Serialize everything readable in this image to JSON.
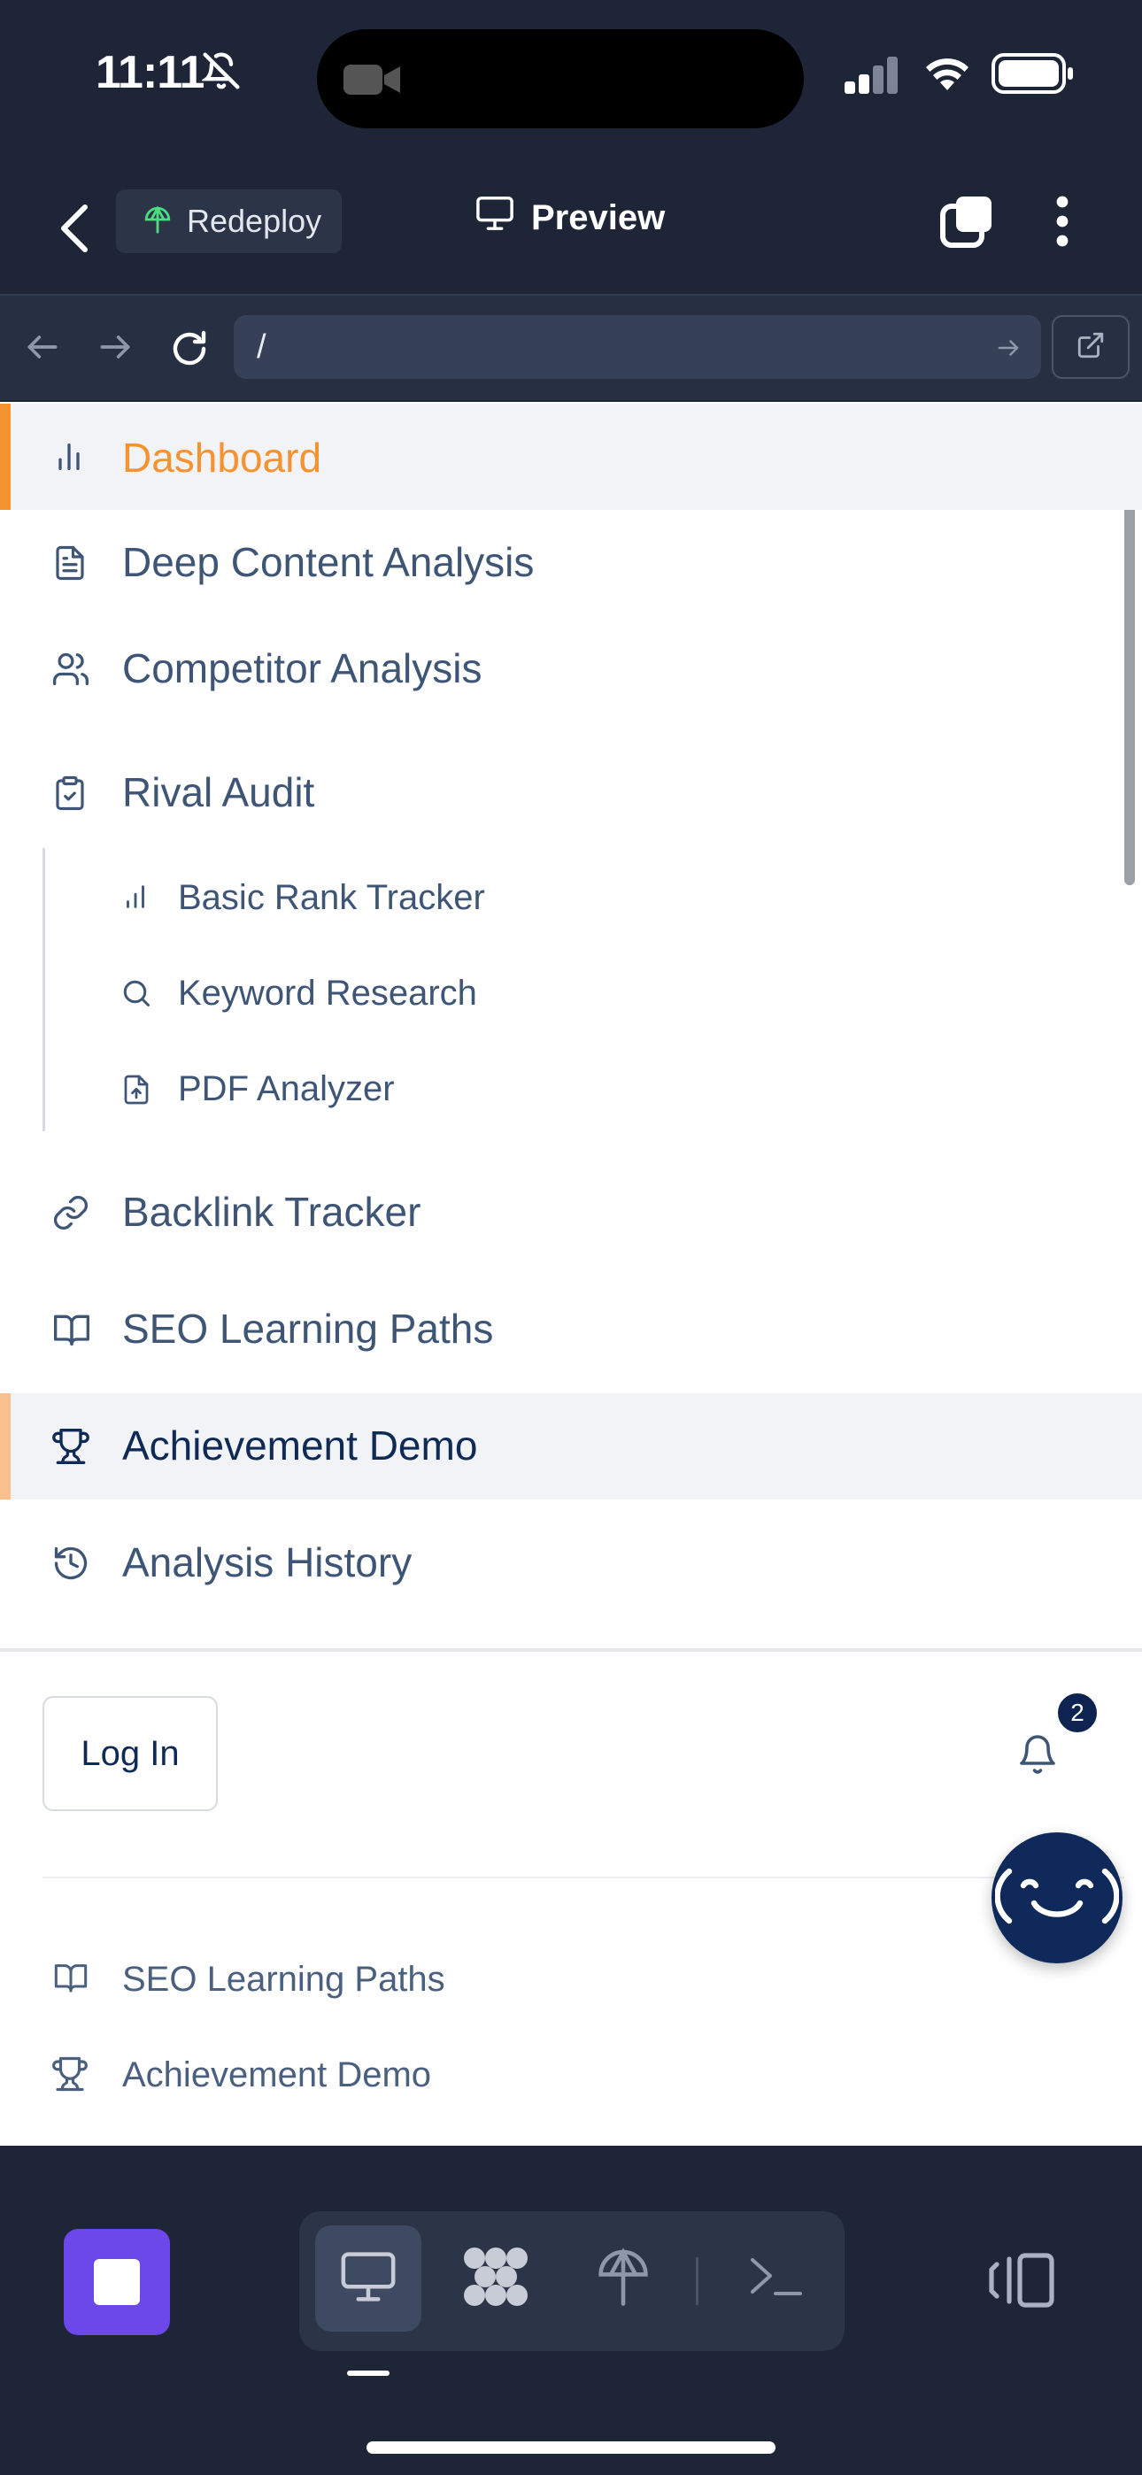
{
  "status_bar": {
    "time": "11:11",
    "icons": [
      "bell-off-icon",
      "camera-icon",
      "signal-icon",
      "wifi-icon",
      "battery-icon"
    ]
  },
  "header": {
    "back_icon": "chevron-left-icon",
    "redeploy_label": "Redeploy",
    "redeploy_icon": "deploy-icon",
    "title": "Preview",
    "title_icon": "monitor-icon",
    "tabs_icon": "tabs-icon",
    "more_icon": "more-vertical-icon"
  },
  "browser": {
    "url": "/",
    "icons": [
      "arrow-left-icon",
      "arrow-right-icon",
      "refresh-icon",
      "arrow-right-icon",
      "external-link-icon"
    ]
  },
  "nav": {
    "items": [
      {
        "label": "Dashboard",
        "icon": "bar-chart-icon",
        "state": "current"
      },
      {
        "label": "Deep Content Analysis",
        "icon": "document-icon"
      },
      {
        "label": "Competitor Analysis",
        "icon": "users-icon"
      },
      {
        "label": "Rival Audit",
        "icon": "clipboard-check-icon"
      },
      {
        "label": "Backlink Tracker",
        "icon": "link-icon"
      },
      {
        "label": "SEO Learning Paths",
        "icon": "book-open-icon"
      },
      {
        "label": "Achievement Demo",
        "icon": "trophy-icon",
        "state": "highlighted"
      },
      {
        "label": "Analysis History",
        "icon": "history-icon"
      }
    ],
    "sub_items": [
      {
        "label": "Basic Rank Tracker",
        "icon": "bar-chart-icon"
      },
      {
        "label": "Keyword Research",
        "icon": "search-icon"
      },
      {
        "label": "PDF Analyzer",
        "icon": "file-upload-icon"
      }
    ]
  },
  "footer": {
    "login_label": "Log In",
    "notification_count": "2",
    "links": [
      {
        "label": "SEO Learning Paths",
        "icon": "book-open-icon"
      },
      {
        "label": "Achievement Demo",
        "icon": "trophy-icon"
      }
    ]
  },
  "toolbar": {
    "icons": [
      "stop-icon",
      "monitor-icon",
      "workspace-icon",
      "deploy-icon",
      "terminal-icon",
      "layout-icon"
    ]
  },
  "colors": {
    "accent_orange": "#f59331",
    "nav_text": "#3e5576",
    "dark_navy": "#0f2a55",
    "app_chrome": "#1d2537",
    "stop_purple": "#6c47ea"
  }
}
